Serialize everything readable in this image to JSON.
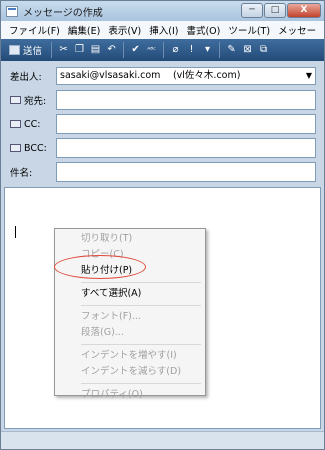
{
  "window": {
    "title": "メッセージの作成"
  },
  "title_buttons": {
    "minimize": "─",
    "maximize": "□",
    "close": "X"
  },
  "menubar": [
    "ファイル(F)",
    "編集(E)",
    "表示(V)",
    "挿入(I)",
    "書式(O)",
    "ツール(T)",
    "メッセー"
  ],
  "toolbar": {
    "send_label": "送信",
    "icons": [
      "cut-icon",
      "copy-icon",
      "paste-icon",
      "undo-icon",
      "check-names-icon",
      "spelling-icon",
      "attach-icon",
      "priority-icon",
      "dropdown-icon",
      "sign-icon",
      "encrypt-icon",
      "offline-icon"
    ],
    "glyphs": [
      "✂",
      "❐",
      "▤",
      "↶",
      "✔",
      "ᴬᴮᶜ",
      "⌀",
      "!",
      "▾",
      "✎",
      "⊠",
      "⧉"
    ]
  },
  "header": {
    "from_label": "差出人:",
    "from_value": "sasaki@vlsasaki.com　 (vl佐々木.com)",
    "to_label": "宛先:",
    "cc_label": "CC:",
    "bcc_label": "BCC:",
    "subject_label": "件名:"
  },
  "context_menu": {
    "items": [
      {
        "label": "切り取り(T)",
        "enabled": false
      },
      {
        "label": "コピー(C)",
        "enabled": false
      },
      {
        "label": "貼り付け(P)",
        "enabled": true
      },
      {
        "label": "すべて選択(A)",
        "enabled": true
      },
      {
        "label": "フォント(F)...",
        "enabled": false
      },
      {
        "label": "段落(G)...",
        "enabled": false
      },
      {
        "label": "インデントを増やす(I)",
        "enabled": false
      },
      {
        "label": "インデントを減らす(D)",
        "enabled": false
      },
      {
        "label": "プロパティ(O)",
        "enabled": false
      }
    ]
  },
  "colors": {
    "highlight_ring": "#e0493a",
    "toolbar_bg": "#2f5d8e"
  }
}
